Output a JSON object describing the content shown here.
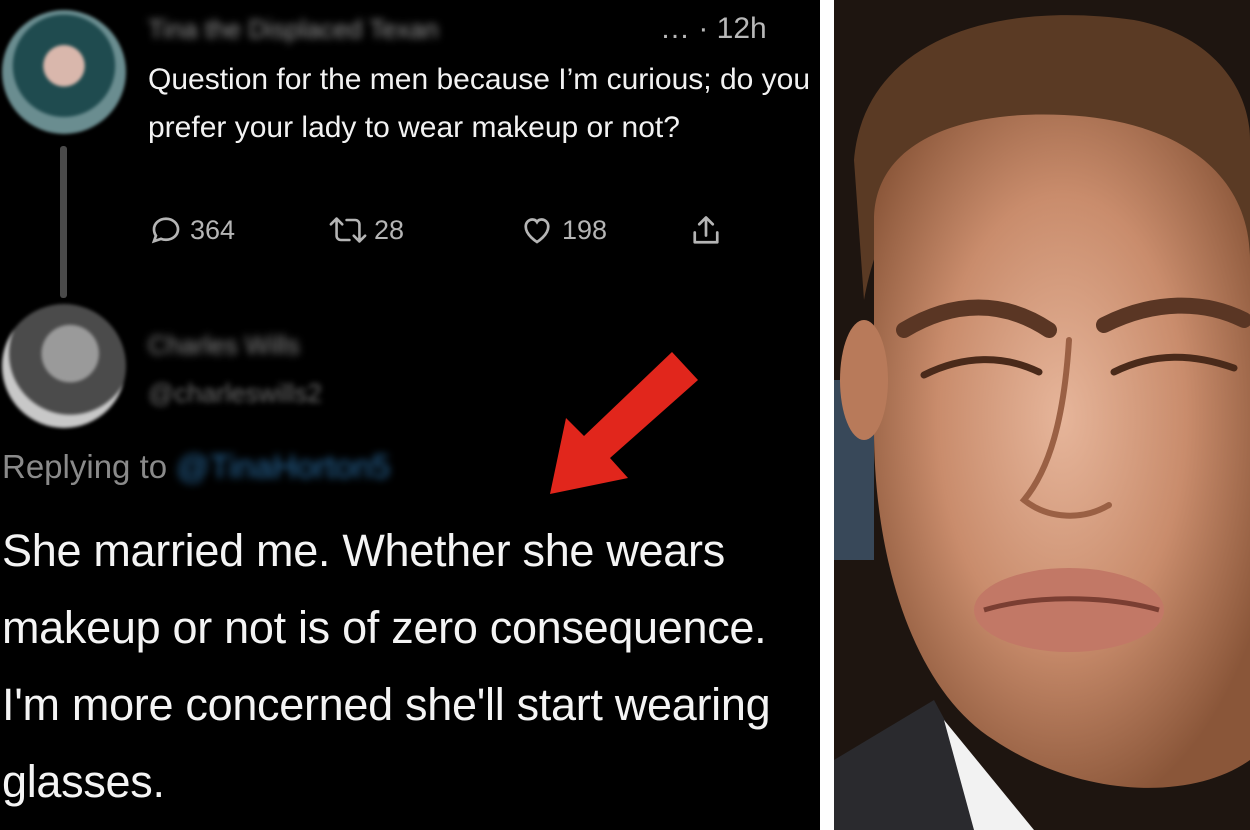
{
  "tweet": {
    "author_name": "Tina the Displaced Texan",
    "meta_suffix": "… · 12h",
    "text": "Question for the men because I’m curious; do you prefer your lady to wear makeup or not?",
    "replies": "364",
    "retweets": "28",
    "likes": "198"
  },
  "reply": {
    "author_name": "Charles Wills",
    "handle": "@charleswills2",
    "replying_label": "Replying to",
    "replying_handle": "@TinaHorton5",
    "text": "She married me. Whether she wears makeup or not is of zero consequence. I'm more concerned she'll start wearing glasses."
  },
  "colors": {
    "background": "#000000",
    "arrow": "#e1261c",
    "mention": "#2b6ea3"
  },
  "icons": [
    "reply-icon",
    "retweet-icon",
    "like-icon",
    "share-icon",
    "red-arrow"
  ]
}
